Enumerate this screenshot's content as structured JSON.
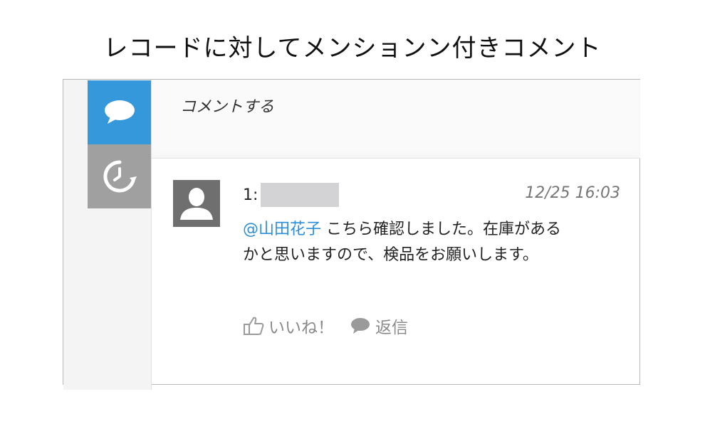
{
  "title": "レコードに対してメンションン付きコメント",
  "sidebar": {
    "tabs": [
      {
        "icon": "comment-bubble-icon",
        "active": true,
        "color": "#3498db"
      },
      {
        "icon": "history-clock-icon",
        "active": false,
        "color": "#a0a0a0"
      }
    ]
  },
  "compose": {
    "placeholder": "コメントする"
  },
  "comment": {
    "number_prefix": "1:",
    "timestamp": "12/25 16:03",
    "mention": "@山田花子",
    "text_line1": " こちら確認しました。在庫がある",
    "text_line2": "かと思いますので、検品をお願いします。",
    "like_label": "いいね！",
    "reply_label": "返信"
  },
  "colors": {
    "accent": "#3498db",
    "mention": "#2b8ed8",
    "muted": "#8a8a8a"
  }
}
